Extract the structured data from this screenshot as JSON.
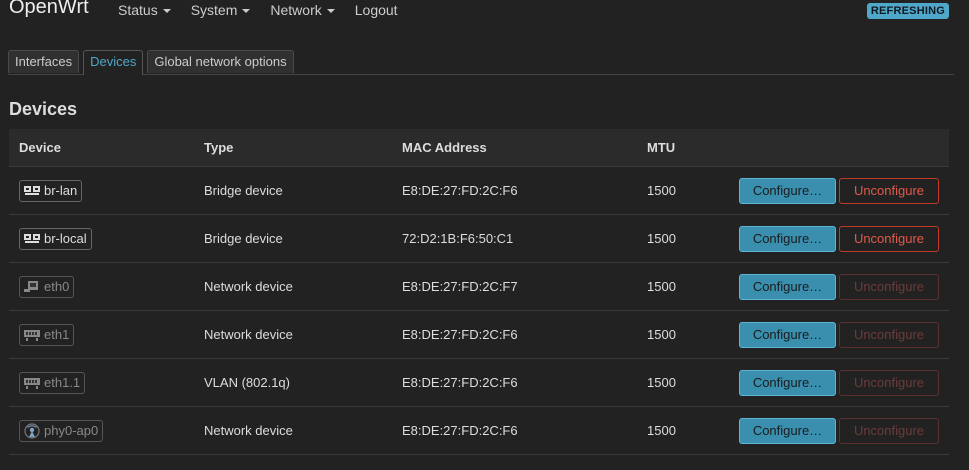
{
  "header": {
    "brand": "OpenWrt",
    "nav": [
      {
        "label": "Status",
        "dropdown": true
      },
      {
        "label": "System",
        "dropdown": true
      },
      {
        "label": "Network",
        "dropdown": true
      },
      {
        "label": "Logout",
        "dropdown": false
      }
    ],
    "badge": "REFRESHING"
  },
  "tabs": [
    {
      "label": "Interfaces",
      "active": false
    },
    {
      "label": "Devices",
      "active": true
    },
    {
      "label": "Global network options",
      "active": false
    }
  ],
  "page_title": "Devices",
  "table": {
    "columns": [
      "Device",
      "Type",
      "MAC Address",
      "MTU",
      ""
    ],
    "rows": [
      {
        "device": "br-lan",
        "icon": "bridge-icon",
        "type": "Bridge device",
        "mac": "E8:DE:27:FD:2C:F6",
        "mtu": "1500",
        "configure": "Configure…",
        "unconfigure": "Unconfigure",
        "unconfigure_enabled": true
      },
      {
        "device": "br-local",
        "icon": "bridge-icon",
        "type": "Bridge device",
        "mac": "72:D2:1B:F6:50:C1",
        "mtu": "1500",
        "configure": "Configure…",
        "unconfigure": "Unconfigure",
        "unconfigure_enabled": true
      },
      {
        "device": "eth0",
        "icon": "ethernet-port-icon",
        "type": "Network device",
        "mac": "E8:DE:27:FD:2C:F7",
        "mtu": "1500",
        "configure": "Configure…",
        "unconfigure": "Unconfigure",
        "unconfigure_enabled": false
      },
      {
        "device": "eth1",
        "icon": "switch-icon",
        "type": "Network device",
        "mac": "E8:DE:27:FD:2C:F6",
        "mtu": "1500",
        "configure": "Configure…",
        "unconfigure": "Unconfigure",
        "unconfigure_enabled": false
      },
      {
        "device": "eth1.1",
        "icon": "switch-icon",
        "type": "VLAN (802.1q)",
        "mac": "E8:DE:27:FD:2C:F6",
        "mtu": "1500",
        "configure": "Configure…",
        "unconfigure": "Unconfigure",
        "unconfigure_enabled": false
      },
      {
        "device": "phy0-ap0",
        "icon": "wifi-icon",
        "type": "Network device",
        "mac": "E8:DE:27:FD:2C:F6",
        "mtu": "1500",
        "configure": "Configure…",
        "unconfigure": "Unconfigure",
        "unconfigure_enabled": false
      }
    ]
  },
  "colors": {
    "background": "#222222",
    "accent": "#4fa8c9",
    "configure_button": "#3a8fae",
    "unconfigure_border": "#c0392b"
  }
}
